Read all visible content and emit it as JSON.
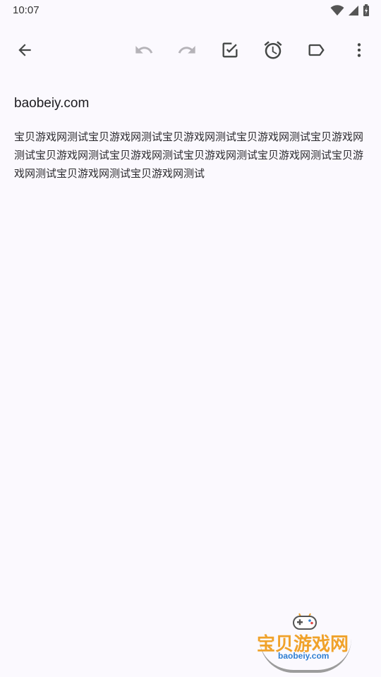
{
  "status_bar": {
    "time": "10:07",
    "icons": [
      "wifi-icon",
      "signal-icon",
      "battery-charging-icon"
    ]
  },
  "toolbar": {
    "icons": [
      "back-arrow-icon",
      "undo-icon",
      "redo-icon",
      "checkbox-icon",
      "alarm-icon",
      "label-icon",
      "more-vert-icon"
    ],
    "undo_enabled": false,
    "redo_enabled": false
  },
  "note": {
    "title": "baobeiy.com",
    "body": "宝贝游戏网测试宝贝游戏网测试宝贝游戏网测试宝贝游戏网测试宝贝游戏网测试宝贝游戏网测试宝贝游戏网测试宝贝游戏网测试宝贝游戏网测试宝贝游戏网测试宝贝游戏网测试宝贝游戏网测试"
  },
  "watermark": {
    "logo_text": "宝贝游戏网",
    "url": "baobeiy.com"
  },
  "colors": {
    "background": "#fbf9fe",
    "icon": "#444746",
    "icon_disabled": "#b5b3b8",
    "watermark_orange": "#f0a22a",
    "watermark_blue": "#2f7fd1"
  }
}
